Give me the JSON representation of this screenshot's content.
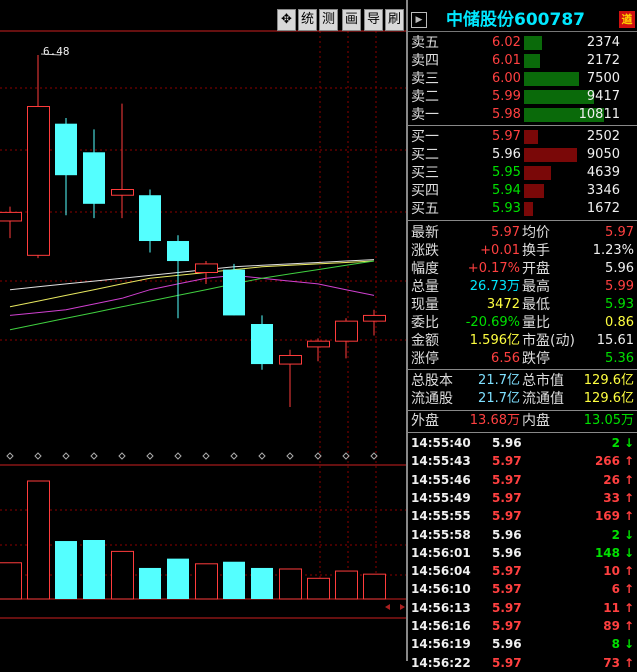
{
  "toolbar": {
    "buttons": [
      {
        "name": "move-tool-button",
        "label": "✥"
      },
      {
        "name": "tongji-button",
        "label": "统"
      },
      {
        "name": "cece-button",
        "label": "测"
      },
      {
        "name": "huaxian-button",
        "label": "画"
      },
      {
        "name": "daochu-button",
        "label": "导"
      },
      {
        "name": "shanxin-button",
        "label": "刷"
      }
    ]
  },
  "chart": {
    "high_marker": "6.48",
    "candles": [
      {
        "o": 5.9,
        "c": 5.93,
        "h": 5.95,
        "l": 5.84,
        "up": true
      },
      {
        "o": 5.78,
        "c": 6.3,
        "h": 6.48,
        "l": 5.77,
        "up": true
      },
      {
        "o": 6.24,
        "c": 6.06,
        "h": 6.26,
        "l": 5.92,
        "up": false
      },
      {
        "o": 6.14,
        "c": 5.96,
        "h": 6.22,
        "l": 5.91,
        "up": false
      },
      {
        "o": 5.99,
        "c": 6.01,
        "h": 6.31,
        "l": 5.91,
        "up": true
      },
      {
        "o": 5.99,
        "c": 5.83,
        "h": 6.01,
        "l": 5.79,
        "up": false
      },
      {
        "o": 5.83,
        "c": 5.76,
        "h": 5.85,
        "l": 5.56,
        "up": false
      },
      {
        "o": 5.72,
        "c": 5.75,
        "h": 5.76,
        "l": 5.68,
        "up": true
      },
      {
        "o": 5.73,
        "c": 5.57,
        "h": 5.75,
        "l": 5.57,
        "up": false
      },
      {
        "o": 5.54,
        "c": 5.4,
        "h": 5.57,
        "l": 5.38,
        "up": false
      },
      {
        "o": 5.4,
        "c": 5.43,
        "h": 5.45,
        "l": 5.25,
        "up": true
      },
      {
        "o": 5.46,
        "c": 5.48,
        "h": 5.49,
        "l": 5.41,
        "up": true
      },
      {
        "o": 5.48,
        "c": 5.55,
        "h": 5.56,
        "l": 5.42,
        "up": true
      },
      {
        "o": 5.55,
        "c": 5.57,
        "h": 5.59,
        "l": 5.5,
        "up": true
      }
    ],
    "ma_white": [
      5.66,
      5.67,
      5.68,
      5.69,
      5.7,
      5.71,
      5.72,
      5.73,
      5.74,
      5.745,
      5.75,
      5.755,
      5.76,
      5.765
    ],
    "ma_yellow": [
      5.6,
      5.62,
      5.64,
      5.66,
      5.68,
      5.7,
      5.71,
      5.72,
      5.73,
      5.74,
      5.745,
      5.75,
      5.755,
      5.76
    ],
    "ma_magenta": [
      5.57,
      5.58,
      5.59,
      5.61,
      5.63,
      5.66,
      5.68,
      5.7,
      5.71,
      5.7,
      5.69,
      5.68,
      5.66,
      5.64
    ],
    "ma_green": [
      5.52,
      5.54,
      5.56,
      5.58,
      5.6,
      5.62,
      5.64,
      5.66,
      5.68,
      5.7,
      5.715,
      5.73,
      5.745,
      5.76
    ],
    "volumes": [
      35,
      114,
      56,
      57,
      46,
      30,
      39,
      34,
      36,
      30,
      29,
      20,
      27,
      24
    ],
    "colors": {
      "up": "#ff3c3c",
      "down": "#54ffff",
      "grid": "#8b0000",
      "axis": "#cc2020"
    }
  },
  "quote": {
    "header": {
      "name": "中储股份",
      "code": "600787",
      "badge": "遒"
    },
    "asks": [
      {
        "label": "卖五",
        "price": "6.02",
        "vol": "2374",
        "frac": 0.22
      },
      {
        "label": "卖四",
        "price": "6.01",
        "vol": "2172",
        "frac": 0.2
      },
      {
        "label": "卖三",
        "price": "6.00",
        "vol": "7500",
        "frac": 0.69
      },
      {
        "label": "卖二",
        "price": "5.99",
        "vol": "9417",
        "frac": 0.87
      },
      {
        "label": "卖一",
        "price": "5.98",
        "vol": "10811",
        "frac": 1.0
      }
    ],
    "bids": [
      {
        "label": "买一",
        "price": "5.97",
        "vol": "2502",
        "frac": 0.23
      },
      {
        "label": "买二",
        "price": "5.96",
        "vol": "9050",
        "frac": 0.84
      },
      {
        "label": "买三",
        "price": "5.95",
        "vol": "4639",
        "frac": 0.43
      },
      {
        "label": "买四",
        "price": "5.94",
        "vol": "3346",
        "frac": 0.31
      },
      {
        "label": "买五",
        "price": "5.93",
        "vol": "1672",
        "frac": 0.15
      }
    ],
    "stats": [
      {
        "l1": "最新",
        "v1": "5.97",
        "c1": "red",
        "l2": "均价",
        "v2": "5.97",
        "c2": "red"
      },
      {
        "l1": "涨跌",
        "v1": "+0.01",
        "c1": "red",
        "l2": "换手",
        "v2": "1.23%",
        "c2": "wht"
      },
      {
        "l1": "幅度",
        "v1": "+0.17%",
        "c1": "red",
        "l2": "开盘",
        "v2": "5.96",
        "c2": "wht"
      },
      {
        "l1": "总量",
        "v1": "26.73万",
        "c1": "cyn",
        "l2": "最高",
        "v2": "5.99",
        "c2": "red"
      },
      {
        "l1": "现量",
        "v1": "3472",
        "c1": "yel",
        "l2": "最低",
        "v2": "5.93",
        "c2": "grn"
      },
      {
        "l1": "委比",
        "v1": "-20.69%",
        "c1": "grn",
        "l2": "量比",
        "v2": "0.86",
        "c2": "yel"
      },
      {
        "l1": "金额",
        "v1": "1.596亿",
        "c1": "yel",
        "l2": "市盈(动)",
        "v2": "15.61",
        "c2": "wht"
      },
      {
        "l1": "涨停",
        "v1": "6.56",
        "c1": "red",
        "l2": "跌停",
        "v2": "5.36",
        "c2": "grn"
      }
    ],
    "capital": [
      {
        "l1": "总股本",
        "v1": "21.7亿",
        "l2": "总市值",
        "v2": "129.6亿"
      },
      {
        "l1": "流通股",
        "v1": "21.7亿",
        "l2": "流通值",
        "v2": "129.6亿"
      }
    ],
    "pan": {
      "out_label": "外盘",
      "out_val": "13.68万",
      "in_label": "内盘",
      "in_val": "13.05万"
    },
    "ticks": [
      {
        "t": "14:55:40",
        "p": "5.96",
        "c": "wht",
        "v": "2",
        "d": "down"
      },
      {
        "t": "14:55:43",
        "p": "5.97",
        "c": "red",
        "v": "266",
        "d": "up"
      },
      {
        "t": "14:55:46",
        "p": "5.97",
        "c": "red",
        "v": "26",
        "d": "up"
      },
      {
        "t": "14:55:49",
        "p": "5.97",
        "c": "red",
        "v": "33",
        "d": "up"
      },
      {
        "t": "14:55:55",
        "p": "5.97",
        "c": "red",
        "v": "169",
        "d": "up"
      },
      {
        "t": "14:55:58",
        "p": "5.96",
        "c": "wht",
        "v": "2",
        "d": "down"
      },
      {
        "t": "14:56:01",
        "p": "5.96",
        "c": "wht",
        "v": "148",
        "d": "down"
      },
      {
        "t": "14:56:04",
        "p": "5.97",
        "c": "red",
        "v": "10",
        "d": "up"
      },
      {
        "t": "14:56:10",
        "p": "5.97",
        "c": "red",
        "v": "6",
        "d": "up"
      },
      {
        "t": "14:56:13",
        "p": "5.97",
        "c": "red",
        "v": "11",
        "d": "up"
      },
      {
        "t": "14:56:16",
        "p": "5.97",
        "c": "red",
        "v": "89",
        "d": "up"
      },
      {
        "t": "14:56:19",
        "p": "5.96",
        "c": "wht",
        "v": "8",
        "d": "down"
      },
      {
        "t": "14:56:22",
        "p": "5.97",
        "c": "red",
        "v": "73",
        "d": "up"
      }
    ]
  }
}
